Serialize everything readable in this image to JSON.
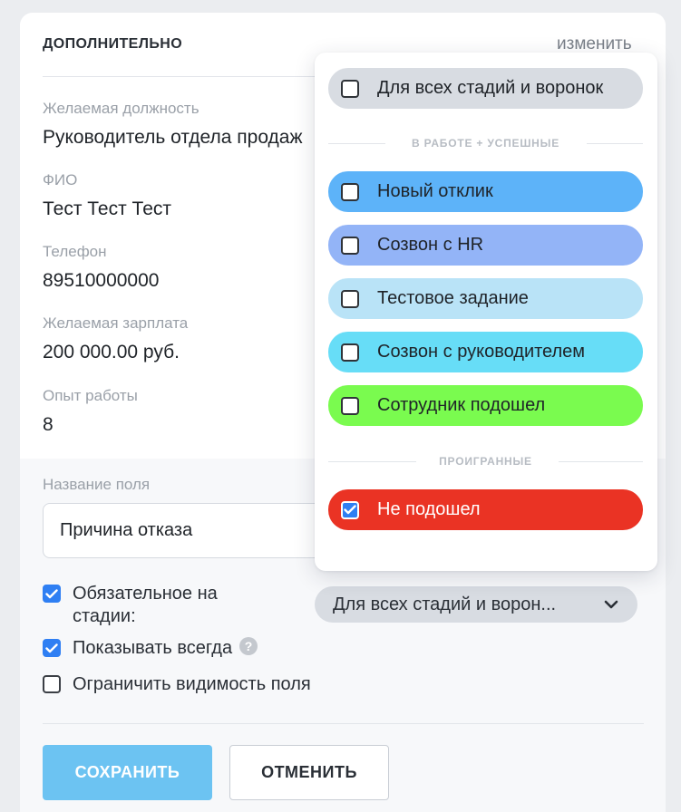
{
  "section": {
    "title": "ДОПОЛНИТЕЛЬНО",
    "edit_link": "изменить"
  },
  "fields": [
    {
      "label": "Желаемая должность",
      "value": "Руководитель отдела продаж"
    },
    {
      "label": "ФИО",
      "value": "Тест Тест Тест"
    },
    {
      "label": "Телефон",
      "value": "89510000000"
    },
    {
      "label": "Желаемая зарплата",
      "value": "200 000.00 руб."
    },
    {
      "label": "Опыт работы",
      "value": "8"
    }
  ],
  "field_name": {
    "label": "Название поля",
    "value": "Причина отказа"
  },
  "options": {
    "required": {
      "label": "Обязательное на стадии:",
      "checked": true
    },
    "always_show": {
      "label": "Показывать всегда",
      "checked": true,
      "help": "?"
    },
    "restrict": {
      "label": "Ограничить видимость поля",
      "checked": false
    }
  },
  "stage_select": {
    "value": "Для всех стадий и ворон..."
  },
  "buttons": {
    "save": "СОХРАНИТЬ",
    "cancel": "ОТМЕНИТЬ"
  },
  "dropdown": {
    "all": {
      "label": "Для всех стадий и воронок",
      "checked": false,
      "color": "#d8dce2"
    },
    "group_active": "В РАБОТЕ + УСПЕШНЫЕ",
    "stages": [
      {
        "label": "Новый отклик",
        "checked": false,
        "color": "#5db3f9"
      },
      {
        "label": "Созвон с HR",
        "checked": false,
        "color": "#93b4f7"
      },
      {
        "label": "Тестовое задание",
        "checked": false,
        "color": "#b9e3f7"
      },
      {
        "label": "Созвон с руководителем",
        "checked": false,
        "color": "#67ddf7"
      },
      {
        "label": "Сотрудник подошел",
        "checked": false,
        "color": "#7afb4f"
      }
    ],
    "group_lost": "ПРОИГРАННЫЕ",
    "lost": [
      {
        "label": "Не подошел",
        "checked": true,
        "color": "#ea3324"
      }
    ]
  }
}
